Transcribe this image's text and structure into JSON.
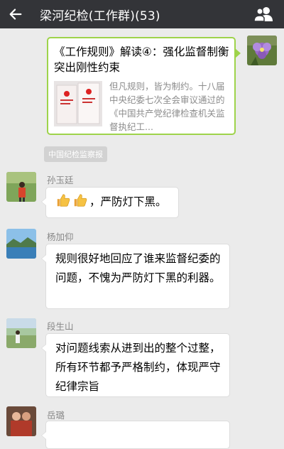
{
  "header": {
    "title": "梁河纪检(工作群)(53)",
    "back_icon": "back-arrow-icon",
    "members_icon": "group-members-icon"
  },
  "shared_article": {
    "title": "《工作规则》解读④：强化监督制衡 突出刚性约束",
    "description": "但凡规则，皆为制约。十八届中央纪委七次全会审议通过的《中国共产党纪律检查机关监督执纪工...",
    "source": "中国纪检监察报"
  },
  "messages": [
    {
      "sender": "孙玉廷",
      "text": "，严防灯下黑。",
      "emoji": "thumbs-up-icon"
    },
    {
      "sender": "杨加仰",
      "text": "规则很好地回应了谁来监督纪委的问题，不愧为严防灯下黑的利器。"
    },
    {
      "sender": "段生山",
      "text": "对问题线索从进到出的整个过整，所有环节都予严格制约，体现严守纪律宗旨"
    },
    {
      "sender": "岳璐",
      "text": ""
    }
  ],
  "colors": {
    "topbar": "#333438",
    "background": "#ebebeb",
    "card_border": "#9ed34a"
  }
}
